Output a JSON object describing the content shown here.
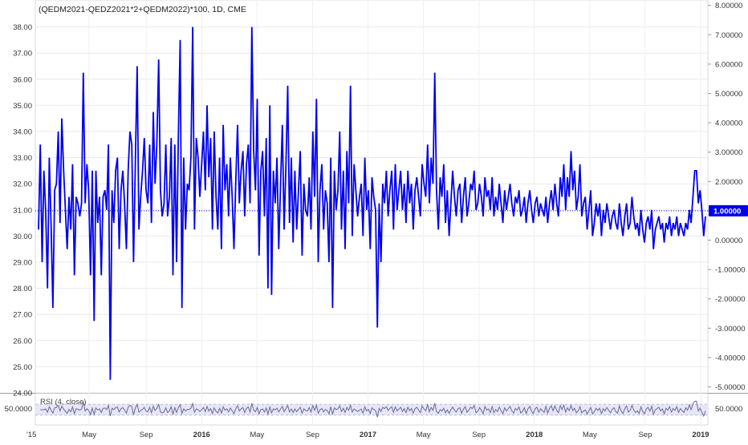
{
  "chart_data": {
    "type": "line",
    "title": "(QEDM2021-QEDZ2021*2+QEDM2022)*100, 1D, CME",
    "series": [
      {
        "values": [
          30.25,
          33.5,
          29.0,
          32.5,
          31.0,
          28.0,
          33.0,
          30.5,
          27.25,
          31.75,
          32.0,
          34.0,
          30.5,
          34.5,
          32.5,
          31.0,
          29.5,
          31.5,
          30.25,
          32.75,
          28.5,
          31.5,
          31.25,
          30.75,
          31.25,
          36.25,
          31.25,
          32.75,
          31.75,
          28.5,
          32.5,
          26.75,
          32.5,
          30.5,
          31.5,
          28.5,
          31.5,
          31.75,
          31.0,
          33.5,
          24.5,
          31.75,
          30.5,
          32.5,
          33.0,
          29.5,
          31.75,
          32.5,
          31.25,
          29.5,
          32.5,
          34.0,
          33.5,
          29.0,
          32.75,
          36.5,
          30.25,
          31.5,
          32.5,
          33.75,
          31.75,
          31.25,
          33.5,
          30.5,
          34.75,
          32.0,
          33.5,
          36.75,
          31.75,
          30.75,
          31.25,
          33.5,
          30.75,
          31.5,
          33.75,
          28.5,
          33.5,
          29.0,
          33.75,
          37.5,
          27.25,
          33.0,
          30.25,
          32.0,
          31.75,
          33.0,
          38.0,
          30.25,
          33.75,
          33.0,
          31.5,
          32.75,
          34.0,
          31.75,
          35.0,
          32.25,
          33.75,
          30.25,
          34.0,
          31.5,
          30.25,
          33.0,
          29.5,
          34.25,
          31.75,
          32.75,
          30.75,
          33.0,
          31.5,
          29.5,
          32.0,
          34.25,
          31.25,
          32.5,
          33.25,
          30.75,
          32.75,
          33.5,
          31.25,
          38.0,
          33.25,
          31.75,
          35.25,
          29.25,
          32.5,
          33.25,
          30.75,
          33.75,
          28.0,
          35.0,
          27.75,
          32.5,
          31.25,
          33.0,
          29.5,
          32.0,
          34.25,
          30.25,
          32.75,
          35.75,
          30.5,
          33.0,
          29.75,
          32.5,
          30.25,
          31.75,
          33.25,
          29.25,
          32.0,
          31.0,
          30.75,
          32.25,
          30.25,
          34.0,
          31.5,
          35.25,
          29.0,
          31.75,
          32.75,
          30.25,
          31.75,
          31.25,
          29.0,
          33.0,
          27.25,
          32.5,
          31.0,
          31.75,
          34.0,
          30.25,
          32.5,
          29.5,
          33.25,
          31.25,
          35.75,
          30.0,
          32.75,
          31.75,
          30.75,
          31.5,
          32.0,
          30.0,
          33.0,
          31.0,
          31.75,
          29.5,
          32.25,
          31.5,
          31.0,
          26.5,
          31.25,
          29.0,
          32.0,
          31.25,
          32.5,
          30.75,
          31.75,
          32.5,
          30.25,
          32.75,
          31.0,
          31.75,
          32.5,
          31.0,
          32.0,
          30.5,
          32.5,
          31.25,
          32.0,
          30.25,
          31.75,
          32.25,
          31.5,
          30.75,
          32.75,
          32.0,
          31.5,
          33.5,
          31.25,
          33.0,
          32.0,
          36.25,
          31.75,
          30.25,
          32.25,
          31.5,
          32.75,
          30.5,
          31.75,
          30.0,
          31.25,
          32.5,
          31.5,
          30.75,
          31.75,
          32.0,
          30.5,
          31.5,
          32.25,
          30.75,
          31.25,
          32.0,
          31.75,
          32.5,
          31.0,
          31.25,
          32.0,
          31.5,
          30.75,
          32.25,
          31.5,
          31.75,
          31.0,
          32.25,
          30.75,
          31.5,
          31.0,
          32.0,
          31.25,
          30.5,
          31.75,
          31.0,
          31.5,
          32.0,
          31.25,
          30.75,
          31.5,
          31.25,
          31.75,
          30.75,
          31.0,
          31.5,
          30.5,
          31.25,
          31.75,
          31.0,
          30.5,
          31.25,
          31.5,
          30.75,
          31.25,
          31.0,
          30.75,
          31.5,
          30.5,
          31.25,
          31.75,
          31.0,
          32.0,
          31.25,
          30.75,
          32.25,
          31.5,
          32.75,
          31.0,
          32.25,
          31.5,
          33.25,
          31.75,
          32.5,
          31.0,
          31.5,
          32.75,
          30.75,
          31.25,
          31.5,
          30.25,
          31.0,
          31.75,
          30.0,
          30.5,
          31.25,
          30.75,
          31.25,
          30.0,
          31.0,
          30.5,
          31.25,
          30.75,
          30.25,
          30.75,
          31.0,
          30.5,
          30.25,
          31.25,
          30.5,
          30.0,
          30.75,
          31.25,
          30.25,
          30.5,
          31.5,
          30.75,
          30.25,
          30.5,
          30.0,
          31.0,
          30.25,
          29.75,
          30.5,
          30.75,
          30.25,
          31.0,
          29.5,
          30.25,
          30.5,
          30.75,
          30.25,
          30.5,
          29.75,
          30.5,
          30.25,
          30.75,
          30.0,
          30.5,
          30.25,
          30.75,
          30.0,
          30.5,
          30.25,
          30.0,
          30.5,
          30.25,
          31.0,
          30.5,
          31.5,
          32.5,
          32.5,
          31.25,
          31.75,
          31.0,
          30.0,
          30.75
        ]
      }
    ],
    "x_range": [
      "2015-03-02",
      "2019-01-31"
    ],
    "ylim_left": [
      24,
      38.5
    ],
    "ylim_right": [
      -5,
      8
    ],
    "y_ticks_left": [
      "24.00",
      "25.00",
      "26.00",
      "27.00",
      "28.00",
      "29.00",
      "30.00",
      "31.00",
      "32.00",
      "33.00",
      "34.00",
      "35.00",
      "36.00",
      "37.00",
      "38.00"
    ],
    "y_ticks_right": [
      "-5.00000",
      "-4.00000",
      "-3.00000",
      "-2.00000",
      "-1.00000",
      "0.00000",
      "1.00000",
      "2.00000",
      "3.00000",
      "4.00000",
      "5.00000",
      "6.00000",
      "7.00000",
      "8.00000"
    ],
    "x_tick_labels": [
      "'15",
      "May",
      "Sep",
      "2016",
      "May",
      "Sep",
      "2017",
      "May",
      "Sep",
      "2018",
      "May",
      "Sep",
      "2019"
    ],
    "x_tick_bold": [
      false,
      false,
      false,
      true,
      false,
      false,
      true,
      false,
      false,
      true,
      false,
      false,
      true
    ],
    "last_value_label": "1.00000",
    "last_value_right_axis": 1.0,
    "line_color": "#0000ee",
    "grid": true,
    "rsi": {
      "label": "RSI (4, close)",
      "value_label": "50.0000",
      "ylim": [
        0,
        100
      ],
      "band": [
        30,
        70
      ],
      "line_color": "#6a6a99",
      "band_color": "#e6e6f5"
    }
  }
}
